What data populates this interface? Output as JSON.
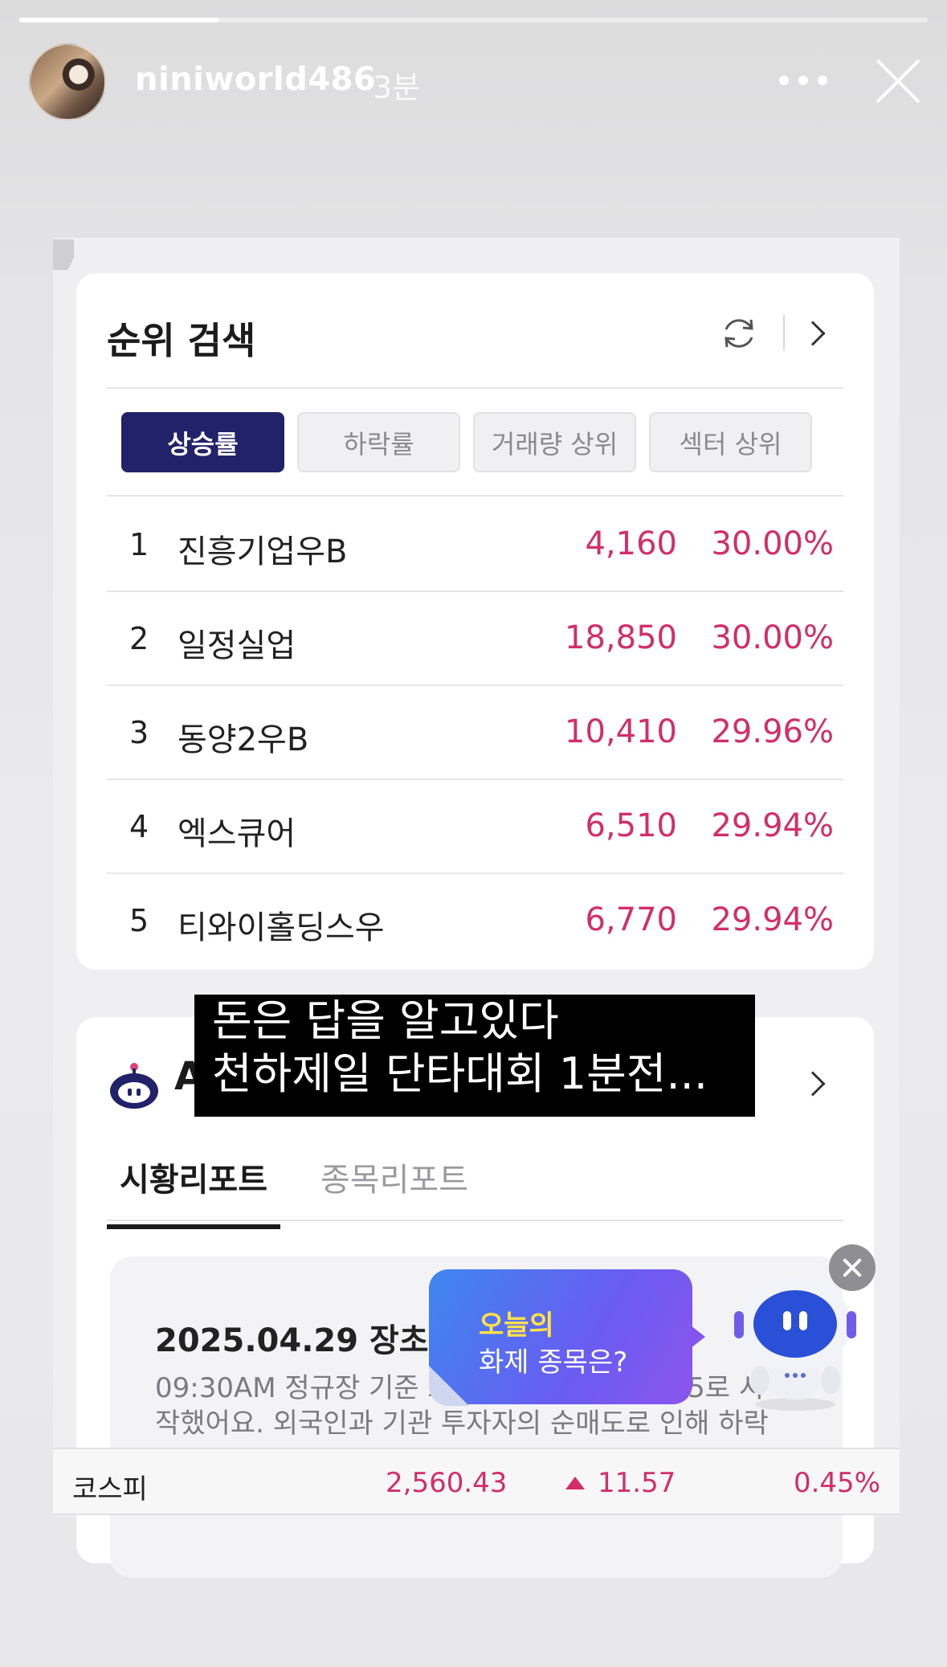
{
  "story": {
    "username": "niniworld486",
    "time_ago": "3분",
    "progress": 0.22
  },
  "rank_search": {
    "title": "순위 검색",
    "tabs": [
      {
        "label": "상승률",
        "active": true
      },
      {
        "label": "하락률",
        "active": false
      },
      {
        "label": "거래량 상위",
        "active": false
      },
      {
        "label": "섹터 상위",
        "active": false
      }
    ],
    "rows": [
      {
        "rank": "1",
        "name": "진흥기업우B",
        "price": "4,160",
        "rate": "30.00%"
      },
      {
        "rank": "2",
        "name": "일정실업",
        "price": "18,850",
        "rate": "30.00%"
      },
      {
        "rank": "3",
        "name": "동양2우B",
        "price": "10,410",
        "rate": "29.96%"
      },
      {
        "rank": "4",
        "name": "엑스큐어",
        "price": "6,510",
        "rate": "29.94%"
      },
      {
        "rank": "5",
        "name": "티와이홀딩스우",
        "price": "6,770",
        "rate": "29.94%"
      }
    ]
  },
  "ai_report": {
    "title_visible": "A",
    "tabs": [
      {
        "label": "시황리포트",
        "active": true
      },
      {
        "label": "종목리포트",
        "active": false
      }
    ],
    "report_date": "2025.04.29 장초반",
    "report_body_line1": "09:30AM 정규장 기준 오",
    "report_body_line1_tail": ".65로 시",
    "report_body_line2": "작했어요. 외국인과 기관 투자자의 순매도로 인해 하락"
  },
  "caption": {
    "line1": "돈은 답을 알고있다",
    "line2": "천하제일 단타대회 1분전..."
  },
  "bubble": {
    "line1": "오늘의",
    "line2": "화제 종목은?"
  },
  "index_bar": {
    "name": "코스피",
    "value": "2,560.43",
    "change": "11.57",
    "rate": "0.45%"
  },
  "colors": {
    "accent_navy": "#22226a",
    "up_red": "#d32e69",
    "bubble_yellow": "#ffe14a"
  }
}
